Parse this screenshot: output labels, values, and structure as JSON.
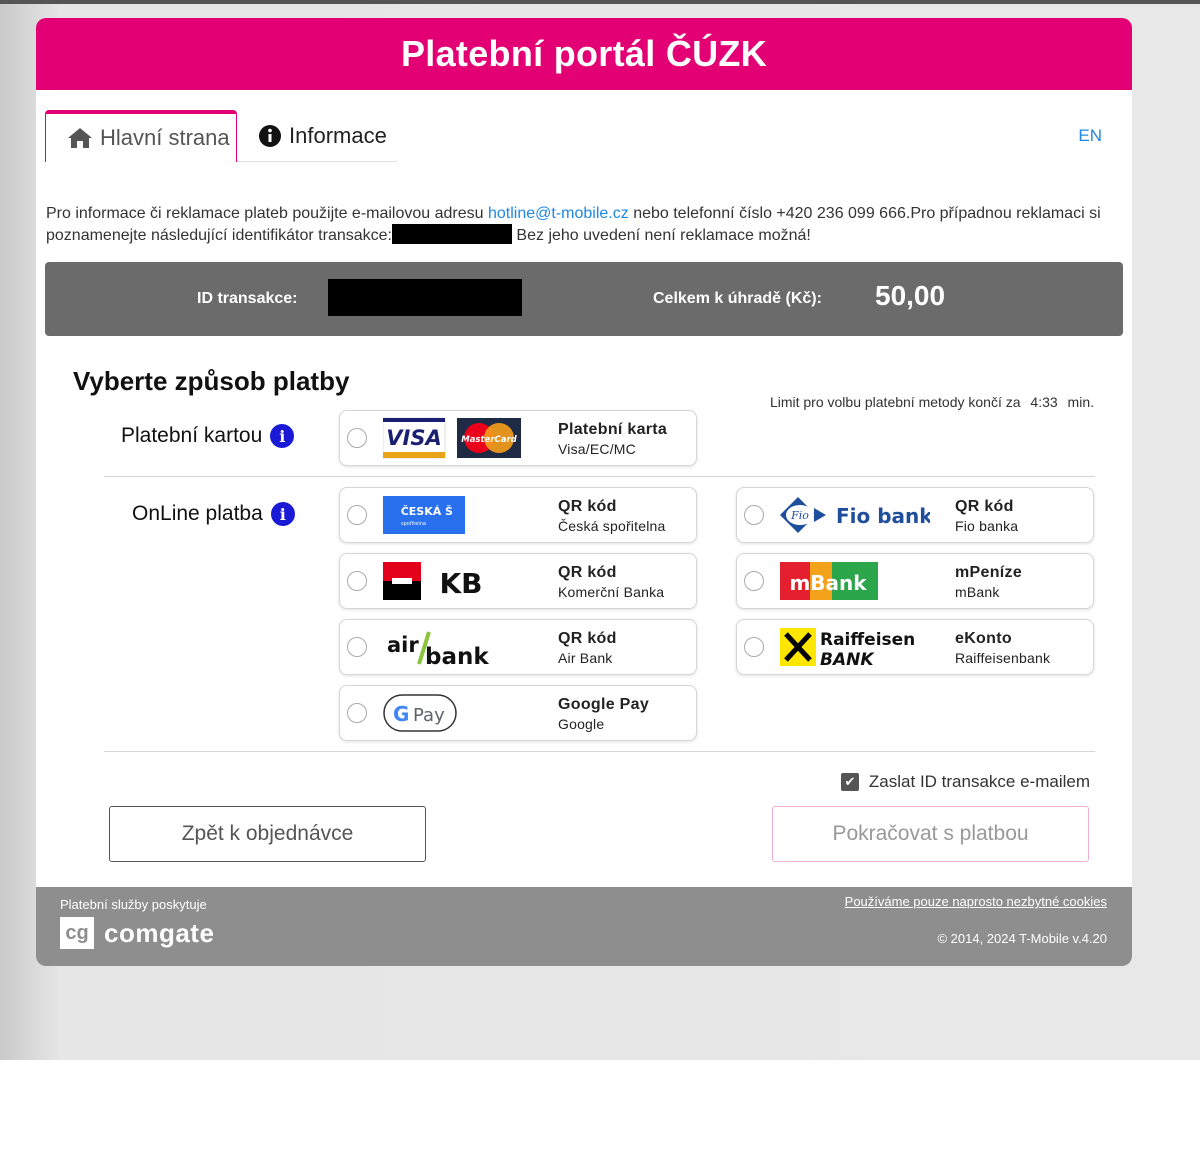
{
  "header": {
    "title": "Platební portál ČÚZK"
  },
  "tabs": {
    "home": "Hlavní strana",
    "info": "Informace"
  },
  "lang": "EN",
  "notice": {
    "before_email": "Pro informace či reklamace plateb použijte e-mailovou adresu ",
    "email": "hotline@t-mobile.cz",
    "after_email": " nebo telefonní číslo +420 236 099 666.Pro případnou reklamaci si poznamenejte následující identifikátor transakce:",
    "tail": " Bez jeho uvedení není reklamace možná!"
  },
  "summary": {
    "id_label": "ID transakce:",
    "total_label": "Celkem k úhradě (Kč):",
    "total_value": "50,00"
  },
  "choose": {
    "title": "Vyberte způsob platby",
    "limit_text": "Limit pro volbu platební metody končí za",
    "limit_time": "4:33",
    "limit_unit": "min."
  },
  "groups": {
    "card": "Platební kartou",
    "online": "OnLine platba"
  },
  "options": {
    "card": {
      "t1": "Platební karta",
      "t2": "Visa/EC/MC"
    },
    "csas": {
      "t1": "QR kód",
      "t2": "Česká spořitelna"
    },
    "fio": {
      "t1": "QR kód",
      "t2": "Fio banka"
    },
    "kb": {
      "t1": "QR kód",
      "t2": "Komerční Banka"
    },
    "mbank": {
      "t1": "mPeníze",
      "t2": "mBank"
    },
    "airbank": {
      "t1": "QR kód",
      "t2": "Air Bank"
    },
    "rb": {
      "t1": "eKonto",
      "t2": "Raiffeisenbank"
    },
    "gpay": {
      "t1": "Google Pay",
      "t2": "Google"
    }
  },
  "logos": {
    "visa": "VISA",
    "mastercard": "MasterCard",
    "csas": "ČESKÁ",
    "csas_sub": "spořitelna",
    "fio_badge": "Fio",
    "fio_text": "Fio banka",
    "kb": "KB",
    "mbank": "mBank",
    "air": "air",
    "bank": "bank",
    "rb1": "Raiffeisen",
    "rb2": "BANK",
    "gpay": "Pay"
  },
  "email_checkbox": {
    "label": "Zaslat ID transakce e-mailem",
    "checked": true
  },
  "buttons": {
    "back": "Zpět k objednávce",
    "continue": "Pokračovat s platbou"
  },
  "footer": {
    "provider": "Platební služby poskytuje",
    "brand_box": "cg",
    "brand": "comgate",
    "cookies": "Používáme pouze naprosto nezbytné cookies",
    "copyright": "© 2014, 2024 T-Mobile v.4.20"
  },
  "colors": {
    "brand": "#e20074",
    "summary_bg": "#6b6b6b",
    "link": "#1e88e5",
    "footer_bg": "#8e8e8e"
  }
}
